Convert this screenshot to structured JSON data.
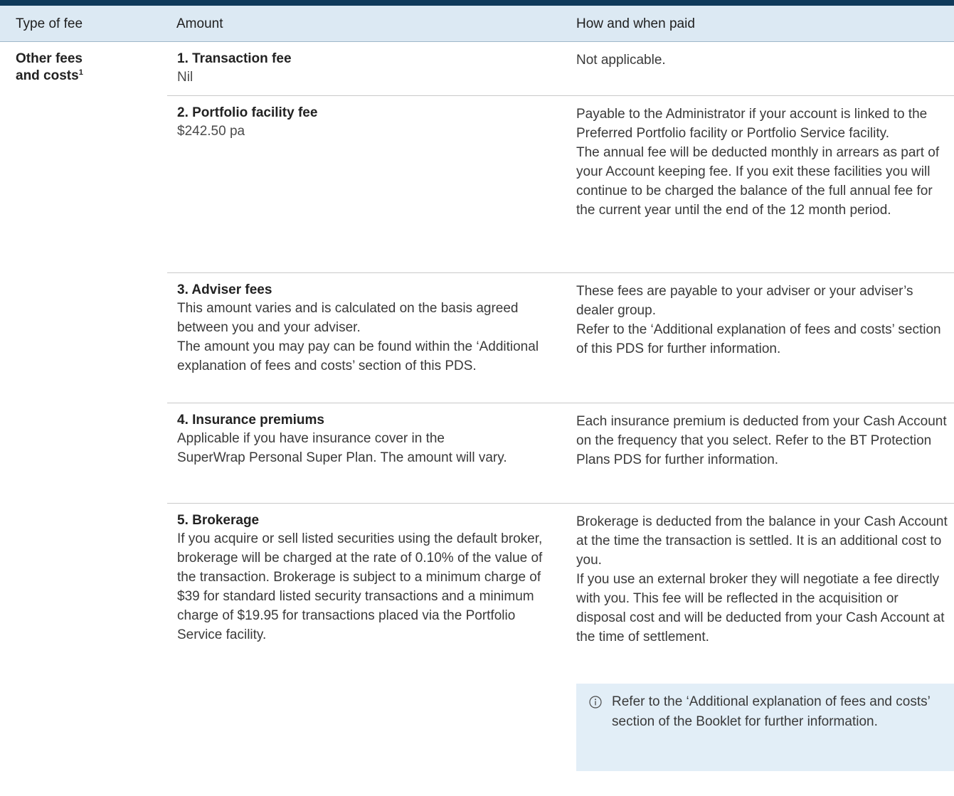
{
  "table": {
    "headers": {
      "type": "Type of fee",
      "amount": "Amount",
      "how": "How and when paid"
    },
    "type_label_line1": "Other fees",
    "type_label_line2": "and costs",
    "type_label_footnote": "1",
    "rows": [
      {
        "title": "1. Transaction fee",
        "amount": [
          "Nil"
        ],
        "how": [
          "Not applicable."
        ]
      },
      {
        "title": "2. Portfolio facility fee",
        "amount": [
          "$242.50 pa"
        ],
        "how": [
          "Payable to the Administrator if your account is linked to the Preferred Portfolio facility or Portfolio Service facility.",
          "The annual fee will be deducted monthly in arrears as part of your Account keeping fee. If you exit these facilities you will continue to be charged the balance of the full annual fee for the current year until the end of the 12 month period."
        ]
      },
      {
        "title": "3. Adviser fees",
        "amount": [
          "This amount varies and is calculated on the basis agreed between you and your adviser.",
          "The amount you may pay can be found within the ‘Additional explanation of fees and costs’ section of this PDS."
        ],
        "how": [
          "These fees are payable to your adviser or your adviser’s dealer group.",
          "Refer to the ‘Additional explanation of fees and costs’ section of this PDS for further information."
        ]
      },
      {
        "title": "4. Insurance premiums",
        "amount": [
          "Applicable if you have insurance cover in the SuperWrap Personal Super Plan. The amount will vary."
        ],
        "how": [
          "Each insurance premium is deducted from your Cash Account on the frequency that you select. Refer to the BT Protection Plans PDS for further information."
        ]
      },
      {
        "title": "5. Brokerage",
        "amount": [
          "If you acquire or sell listed securities using the default broker, brokerage will be charged at the rate of 0.10% of the value of the transaction. Brokerage is subject to a minimum charge of $39 for standard listed security transactions and a minimum charge of $19.95 for transactions placed via the Portfolio Service facility."
        ],
        "how": [
          "Brokerage is deducted from the balance in your Cash Account at the time the transaction is settled. It is an additional cost to you.",
          "If you use an external broker they will negotiate a fee directly with you. This fee will be reflected in the acquisition or disposal cost and will be deducted from your Cash Account at the time of settlement."
        ]
      }
    ]
  },
  "info_note": {
    "icon": "info-icon",
    "text": "Refer to the ‘Additional explanation of fees and costs’ section of the Booklet for further information."
  },
  "colors": {
    "top_bar": "#0f3a5a",
    "header_bg": "#dce9f3",
    "note_bg": "#e2eef7"
  }
}
